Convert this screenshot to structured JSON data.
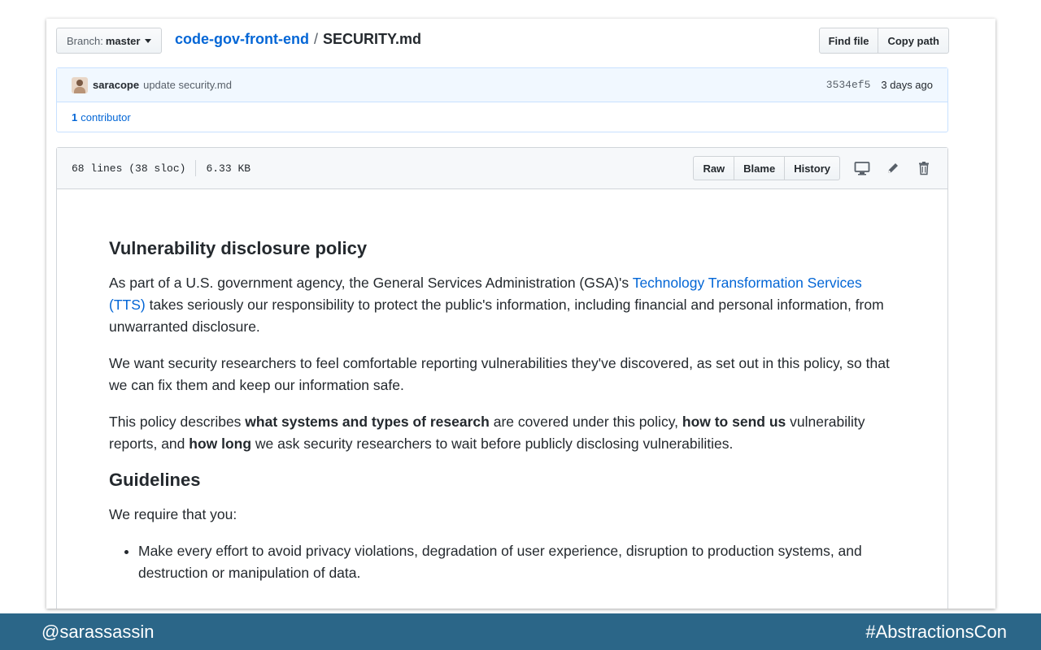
{
  "header": {
    "branch_prefix": "Branch:",
    "branch_name": "master",
    "repo": "code-gov-front-end",
    "separator": "/",
    "file": "SECURITY.md",
    "find_file": "Find file",
    "copy_path": "Copy path"
  },
  "commit": {
    "author": "saracope",
    "message": "update security.md",
    "sha": "3534ef5",
    "age": "3 days ago",
    "contrib_count": "1",
    "contrib_label": "contributor"
  },
  "file": {
    "lines": "68 lines (38 sloc)",
    "size": "6.33 KB",
    "raw": "Raw",
    "blame": "Blame",
    "history": "History"
  },
  "content": {
    "h1": "Vulnerability disclosure policy",
    "p1_a": "As part of a U.S. government agency, the General Services Administration (GSA)'s ",
    "p1_link": "Technology Transformation Services (TTS)",
    "p1_b": " takes seriously our responsibility to protect the public's information, including financial and personal information, from unwarranted disclosure.",
    "p2": "We want security researchers to feel comfortable reporting vulnerabilities they've discovered, as set out in this policy, so that we can fix them and keep our information safe.",
    "p3_a": "This policy describes ",
    "p3_b1": "what systems and types of research",
    "p3_c": " are covered under this policy, ",
    "p3_b2": "how to send us",
    "p3_d": " vulnerability reports, and ",
    "p3_b3": "how long",
    "p3_e": " we ask security researchers to wait before publicly disclosing vulnerabilities.",
    "h2": "Guidelines",
    "p4": "We require that you:",
    "li1": "Make every effort to avoid privacy violations, degradation of user experience, disruption to production systems, and destruction or manipulation of data."
  },
  "footer": {
    "left": "@sarassassin",
    "right": "#AbstractionsCon"
  }
}
